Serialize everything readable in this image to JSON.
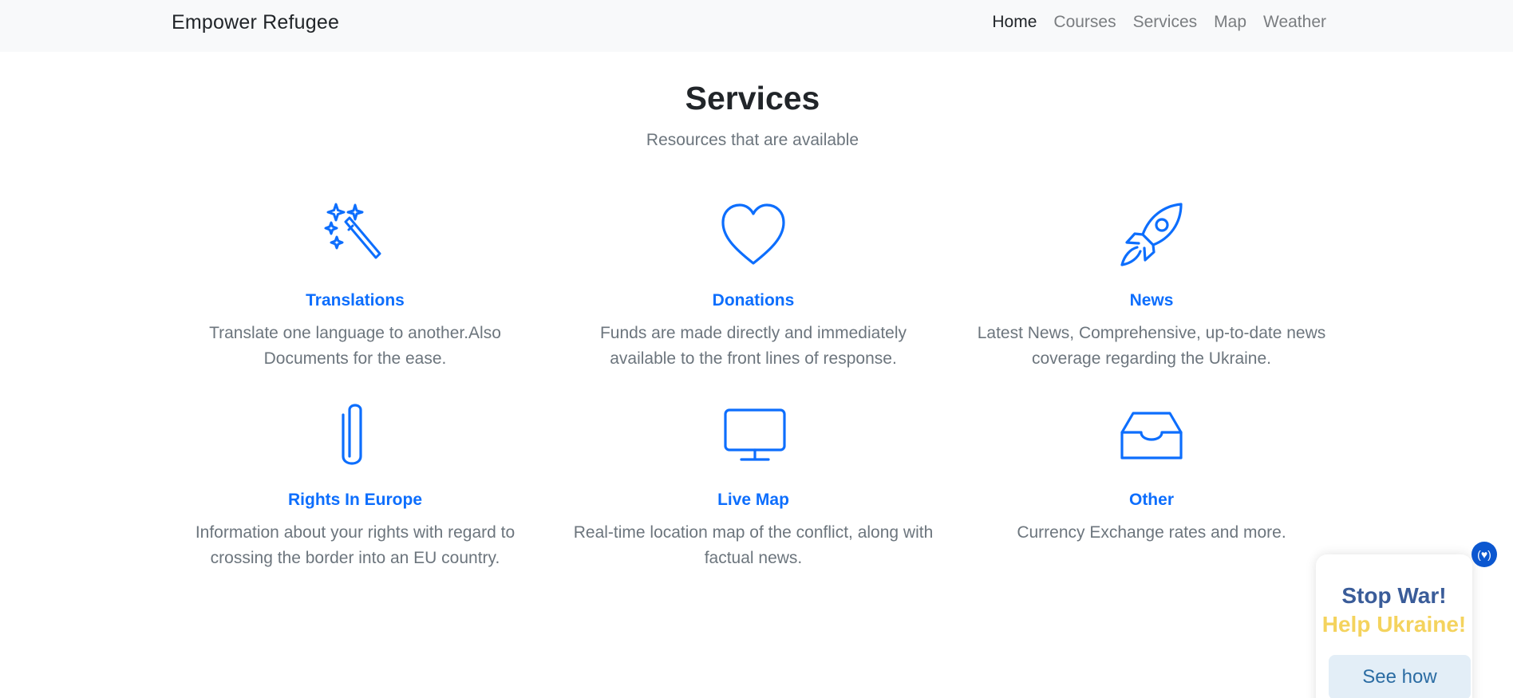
{
  "navbar": {
    "brand": "Empower Refugee",
    "links": [
      {
        "label": "Home",
        "active": true
      },
      {
        "label": "Courses",
        "active": false
      },
      {
        "label": "Services",
        "active": false
      },
      {
        "label": "Map",
        "active": false
      },
      {
        "label": "Weather",
        "active": false
      }
    ]
  },
  "section": {
    "title": "Services",
    "subtitle": "Resources that are available"
  },
  "services": [
    {
      "icon": "magic-wand-icon",
      "title": "Translations",
      "description": "Translate one language to another.Also Documents for the ease."
    },
    {
      "icon": "heart-icon",
      "title": "Donations",
      "description": "Funds are made directly and immediately available to the front lines of response."
    },
    {
      "icon": "rocket-icon",
      "title": "News",
      "description": "Latest News, Comprehensive, up-to-date news coverage regarding the Ukraine."
    },
    {
      "icon": "paperclip-icon",
      "title": "Rights In Europe",
      "description": "Information about your rights with regard to crossing the border into an EU country."
    },
    {
      "icon": "monitor-icon",
      "title": "Live Map",
      "description": "Real-time location map of the conflict, along with factual news."
    },
    {
      "icon": "inbox-icon",
      "title": "Other",
      "description": "Currency Exchange rates and more."
    }
  ],
  "ukraine_widget": {
    "line1": "Stop War!",
    "line2": "Help Ukraine!",
    "button": "See how",
    "toggle_icon": "heart-icon"
  },
  "colors": {
    "accent": "#0d6efd",
    "muted_text": "#6c757d",
    "navbar_bg": "#f8f9fa",
    "ukraine_blue": "#3a5c99",
    "ukraine_yellow": "#f4d35e"
  }
}
